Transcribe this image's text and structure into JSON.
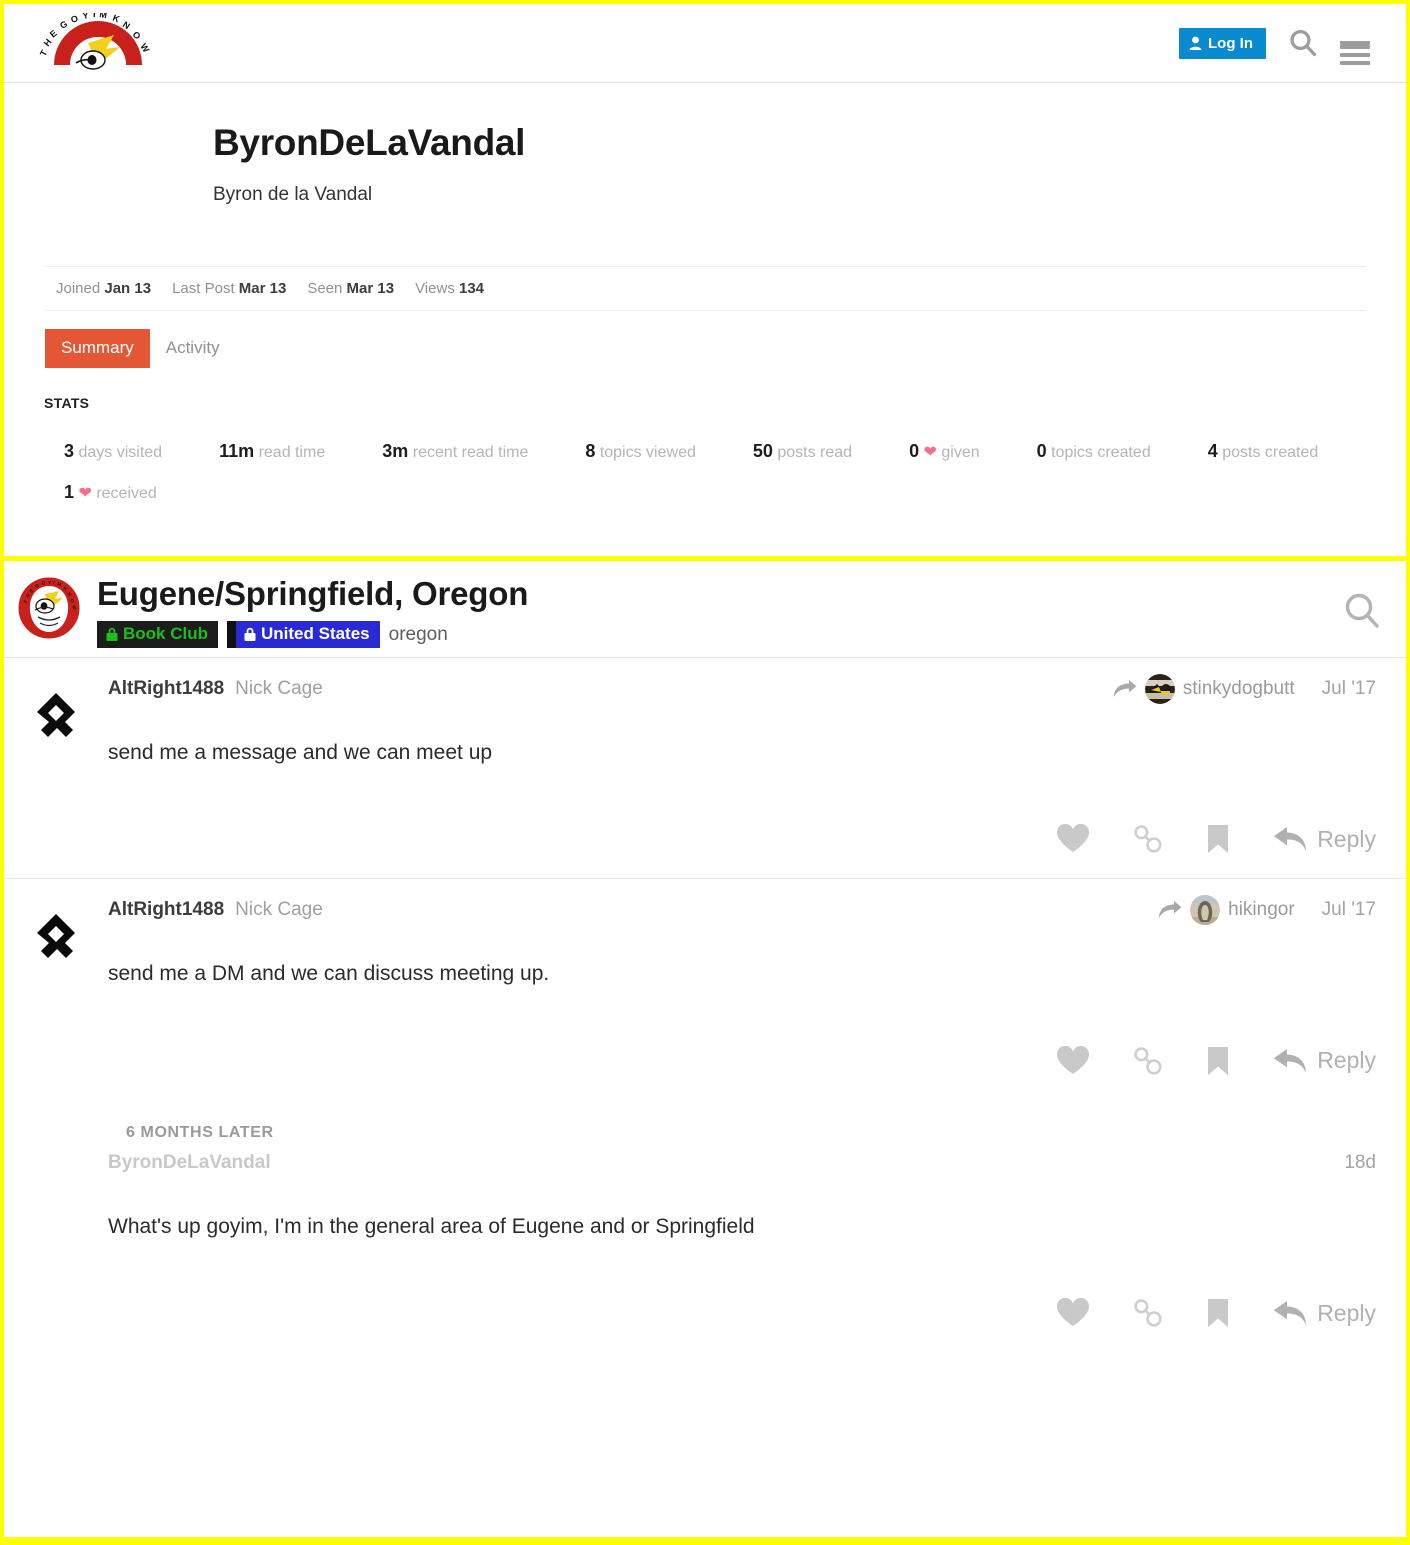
{
  "site": {
    "logo_icon": "goyim-know-logo",
    "login_label": "Log In",
    "login_icon": "user-icon",
    "search_icon": "search-icon",
    "menu_icon": "hamburger-menu-icon",
    "accent_blue": "#0a8bd0"
  },
  "profile": {
    "username": "ByronDeLaVandal",
    "fullname": "Byron de la Vandal",
    "meta": [
      {
        "label": "Joined",
        "value": "Jan 13"
      },
      {
        "label": "Last Post",
        "value": "Mar 13"
      },
      {
        "label": "Seen",
        "value": "Mar 13"
      },
      {
        "label": "Views",
        "value": "134"
      }
    ],
    "tabs": [
      {
        "label": "Summary",
        "active": true
      },
      {
        "label": "Activity",
        "active": false
      }
    ],
    "active_tab_color": "#e45735",
    "stats_heading": "STATS",
    "stats": [
      {
        "value": "3",
        "label": "days visited"
      },
      {
        "value": "11m",
        "label": "read time"
      },
      {
        "value": "3m",
        "label": "recent read time"
      },
      {
        "value": "8",
        "label": "topics viewed"
      },
      {
        "value": "50",
        "label": "posts read"
      },
      {
        "value": "0",
        "icon": "heart-icon",
        "label": "given"
      },
      {
        "value": "0",
        "label": "topics created"
      },
      {
        "value": "4",
        "label": "posts created"
      },
      {
        "value": "1",
        "icon": "heart-icon",
        "label": "received"
      }
    ],
    "heart_color": "#fa6c8d"
  },
  "topic": {
    "avatar_icon": "goyim-know-eagle-avatar",
    "title": "Eugene/Springfield, Oregon",
    "badges": [
      {
        "label": "Book Club",
        "icon": "lock-icon",
        "bg": "#1c1c1c",
        "fg": "#18c018"
      },
      {
        "label": "United States",
        "icon": "lock-icon",
        "bg": "#2a2ad4",
        "fg": "#ffffff"
      }
    ],
    "tag": "oregon",
    "search_icon": "search-icon",
    "posts": [
      {
        "avatar_icon": "othala-rune-avatar",
        "username": "AltRight1488",
        "fullname": "Nick Cage",
        "reply_to": "stinkydogbutt",
        "reply_to_avatar_icon": "stinkydogbutt-avatar",
        "date": "Jul '17",
        "text": "send me a message and we can meet up",
        "actions": {
          "like_icon": "heart-icon",
          "link_icon": "chain-link-icon",
          "bookmark_icon": "bookmark-icon",
          "reply_icon": "reply-arrow-icon",
          "reply_label": "Reply"
        }
      },
      {
        "avatar_icon": "othala-rune-avatar",
        "username": "AltRight1488",
        "fullname": "Nick Cage",
        "reply_to": "hikingor",
        "reply_to_avatar_icon": "hikingor-avatar",
        "date": "Jul '17",
        "text": "send me a DM and we can discuss meeting up.",
        "actions": {
          "like_icon": "heart-icon",
          "link_icon": "chain-link-icon",
          "bookmark_icon": "bookmark-icon",
          "reply_icon": "reply-arrow-icon",
          "reply_label": "Reply"
        }
      },
      {
        "time_gap": "6 MONTHS LATER",
        "username": "ByronDeLaVandal",
        "fullname": "",
        "date": "18d",
        "text": "What's up goyim, I'm in the general area of Eugene and or Springfield",
        "actions": {
          "like_icon": "heart-icon",
          "link_icon": "chain-link-icon",
          "bookmark_icon": "bookmark-icon",
          "reply_icon": "reply-arrow-icon",
          "reply_label": "Reply"
        }
      }
    ]
  }
}
